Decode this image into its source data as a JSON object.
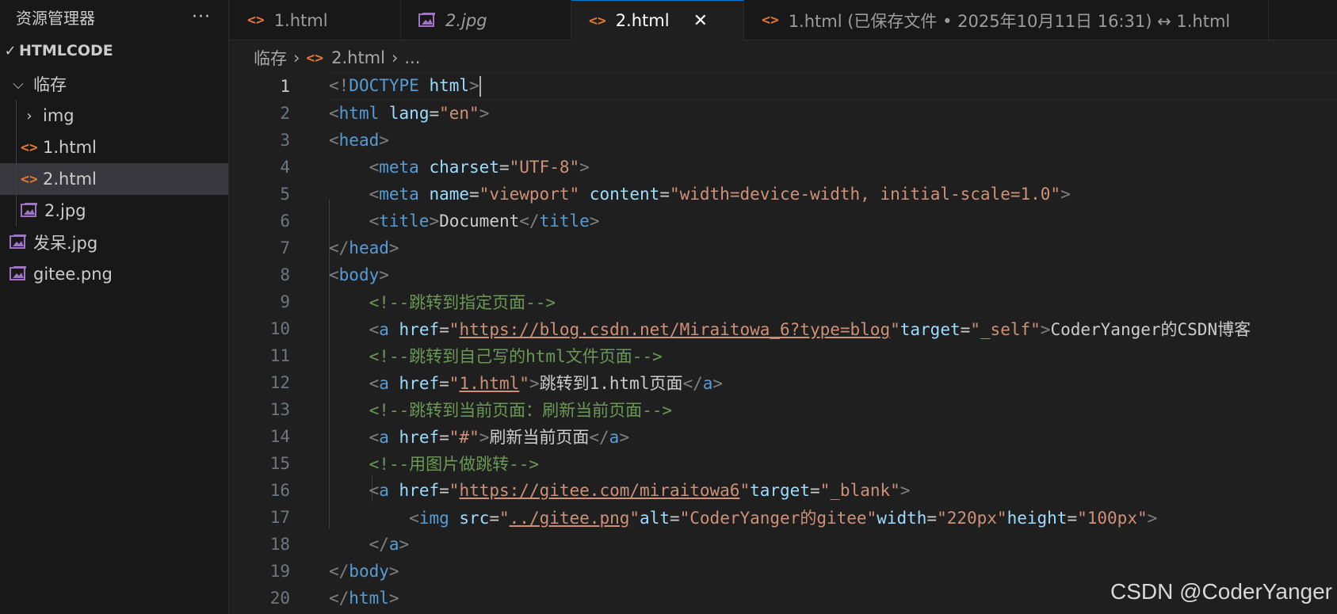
{
  "explorer": {
    "title": "资源管理器",
    "more": "···",
    "root": "HTMLCODE",
    "items": [
      {
        "label": "临存",
        "kind": "folder-open"
      },
      {
        "label": "img",
        "kind": "folder"
      },
      {
        "label": "1.html",
        "kind": "html"
      },
      {
        "label": "2.html",
        "kind": "html",
        "selected": true
      },
      {
        "label": "2.jpg",
        "kind": "image"
      },
      {
        "label": "发呆.jpg",
        "kind": "image"
      },
      {
        "label": "gitee.png",
        "kind": "image"
      }
    ]
  },
  "tabs": [
    {
      "label": "1.html",
      "kind": "html"
    },
    {
      "label": "2.jpg",
      "kind": "image"
    },
    {
      "label": "2.html",
      "kind": "html",
      "active": true,
      "close": "✕"
    },
    {
      "label": "1.html (已保存文件 • 2025年10月11日 16:31) ↔ 1.html",
      "kind": "html"
    }
  ],
  "breadcrumb": {
    "folder": "临存",
    "file": "2.html",
    "rest": "..."
  },
  "editor": {
    "current_line": 1,
    "line_numbers": [
      "1",
      "2",
      "3",
      "4",
      "5",
      "6",
      "7",
      "8",
      "9",
      "10",
      "11",
      "12",
      "13",
      "14",
      "15",
      "16",
      "17",
      "18",
      "19",
      "20"
    ]
  },
  "watermark": "CSDN @CoderYanger",
  "colors": {
    "accent": "#0078d4",
    "html_icon": "#e37933",
    "image_icon": "#a074c4"
  }
}
